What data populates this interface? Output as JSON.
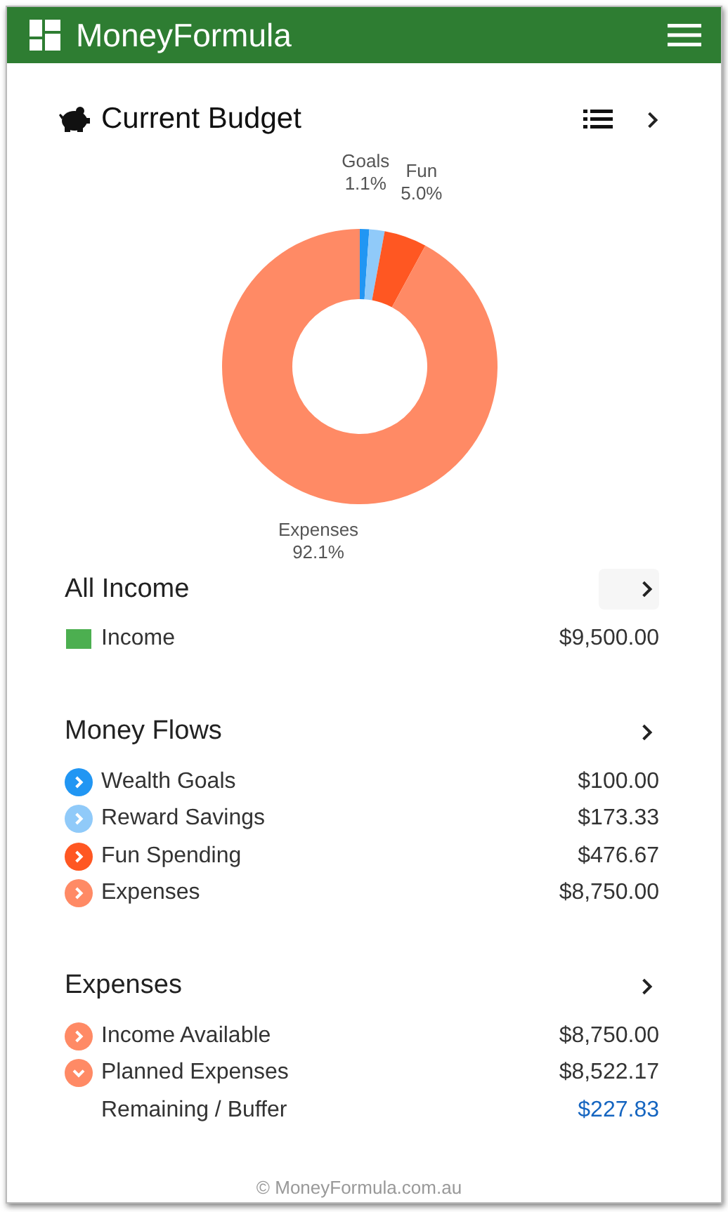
{
  "app_bar": {
    "title": "MoneyFormula"
  },
  "budget": {
    "title": "Current Budget",
    "chart_data": {
      "type": "donut",
      "categories": [
        "Goals",
        null,
        "Fun",
        "Expenses"
      ],
      "series": [
        {
          "values": [
            1.1,
            1.8,
            5.0,
            92.1
          ],
          "colors": [
            "#2196f3",
            "#90caf9",
            "#ff5722",
            "#ff8a65"
          ]
        }
      ],
      "value_labels": [
        "1.1%",
        null,
        "5.0%",
        "92.1%"
      ]
    }
  },
  "sections": [
    {
      "title": "All Income",
      "rows": [
        {
          "kind": "square",
          "color": "#4caf50",
          "label": "Income",
          "amount": "$9,500.00",
          "highlighted": false
        }
      ]
    },
    {
      "title": "Money Flows",
      "rows": [
        {
          "kind": "chevron-right",
          "color": "#2196f3",
          "label": "Wealth Goals",
          "amount": "$100.00",
          "highlighted": false
        },
        {
          "kind": "chevron-right",
          "color": "#90caf9",
          "label": "Reward Savings",
          "amount": "$173.33",
          "highlighted": false
        },
        {
          "kind": "chevron-right",
          "color": "#ff5722",
          "label": "Fun Spending",
          "amount": "$476.67",
          "highlighted": false
        },
        {
          "kind": "chevron-right",
          "color": "#ff8a65",
          "label": "Expenses",
          "amount": "$8,750.00",
          "highlighted": false
        }
      ]
    },
    {
      "title": "Expenses",
      "rows": [
        {
          "kind": "chevron-right",
          "color": "#ff8a65",
          "label": "Income Available",
          "amount": "$8,750.00",
          "highlighted": false
        },
        {
          "kind": "chevron-down",
          "color": "#ff8a65",
          "label": "Planned Expenses",
          "amount": "$8,522.17",
          "highlighted": false
        },
        {
          "kind": "plain",
          "label": "Remaining / Buffer",
          "amount": "$227.83",
          "highlighted": true
        }
      ]
    }
  ],
  "footer": "© MoneyFormula.com.au"
}
